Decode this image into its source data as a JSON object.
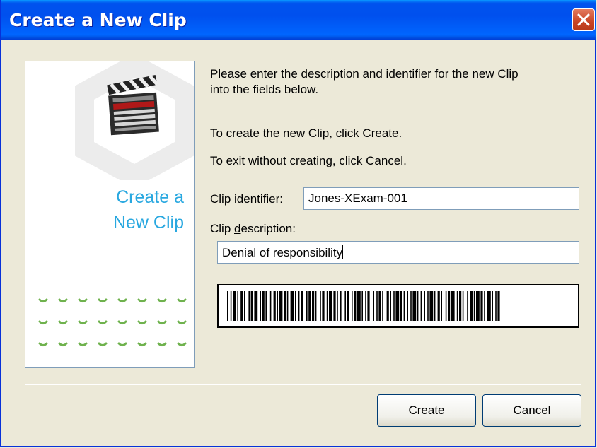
{
  "window": {
    "title": "Create a New Clip"
  },
  "panel": {
    "title_line1": "Create a",
    "title_line2": "New Clip",
    "illustration": "clapperboard-icon"
  },
  "instructions": {
    "line1": "Please enter the description and identifier for the new Clip",
    "line2": "into the fields below.",
    "create_hint": "To create the new Clip, click Create.",
    "cancel_hint": "To exit without creating, click Cancel."
  },
  "identifier": {
    "label_pre": "Clip ",
    "label_accel": "i",
    "label_post": "dentifier:",
    "value": "Jones-XExam-001"
  },
  "description": {
    "label_pre": "Clip ",
    "label_accel": "d",
    "label_post": "escription:",
    "value": "Denial of responsibility"
  },
  "buttons": {
    "create_accel": "C",
    "create_rest": "reate",
    "cancel": "Cancel"
  },
  "colors": {
    "title_bar": "#0054e3",
    "panel_text": "#29a8e0",
    "dots": "#6fb24e",
    "close_button": "#c94425"
  }
}
